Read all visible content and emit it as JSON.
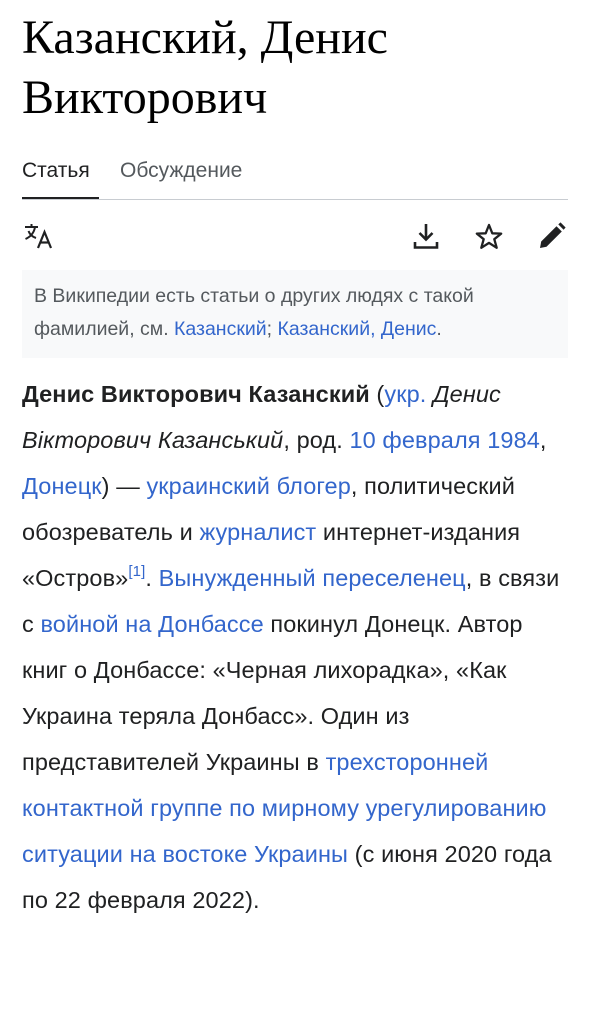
{
  "title": "Казанский, Денис Викторович",
  "tabs": [
    {
      "label": "Статья",
      "active": true
    },
    {
      "label": "Обсуждение",
      "active": false
    }
  ],
  "toolbar": {
    "icons": [
      "language-icon",
      "download-icon",
      "star-icon",
      "edit-icon"
    ]
  },
  "hatnote": {
    "text": "В Википедии есть статьи о других людях с такой фамилией, см. ",
    "link1": "Казанский",
    "sep": "; ",
    "link2": "Казанский, Денис",
    "end": "."
  },
  "article": {
    "name": "Денис Викторович Казанский",
    "p1": " (",
    "lang_link": "укр.",
    "uk_name": " Денис Вікторович Казанський",
    "p2": ", род. ",
    "birth_date": "10 февраля 1984",
    "p3": ", ",
    "birth_place": "Донецк",
    "p4": ") — ",
    "l_ukr_blogger": "украинский блогер",
    "p5": ", политический обозреватель и ",
    "l_journalist": "журналист",
    "p6": " интернет-издания «Остров»",
    "ref1": "[1]",
    "p7": ". ",
    "l_displaced": "Вынужденный переселенец",
    "p8": ", в связи с ",
    "l_war": "войной на Донбассе",
    "p9": " покинул Донецк. Автор книг о Донбассе: «Черная лихорадка», «Как Украина теряла Донбасс». Один из представителей Украины в ",
    "l_tcg": "трехсторонней контактной группе по мирному урегулированию ситуации на востоке Украины",
    "p10": " (с июня 2020 года по 22 февраля 2022)."
  },
  "colors": {
    "link": "#3366cc",
    "text": "#202122",
    "muted": "#54595d",
    "hatnote_bg": "#f8f9fa"
  }
}
